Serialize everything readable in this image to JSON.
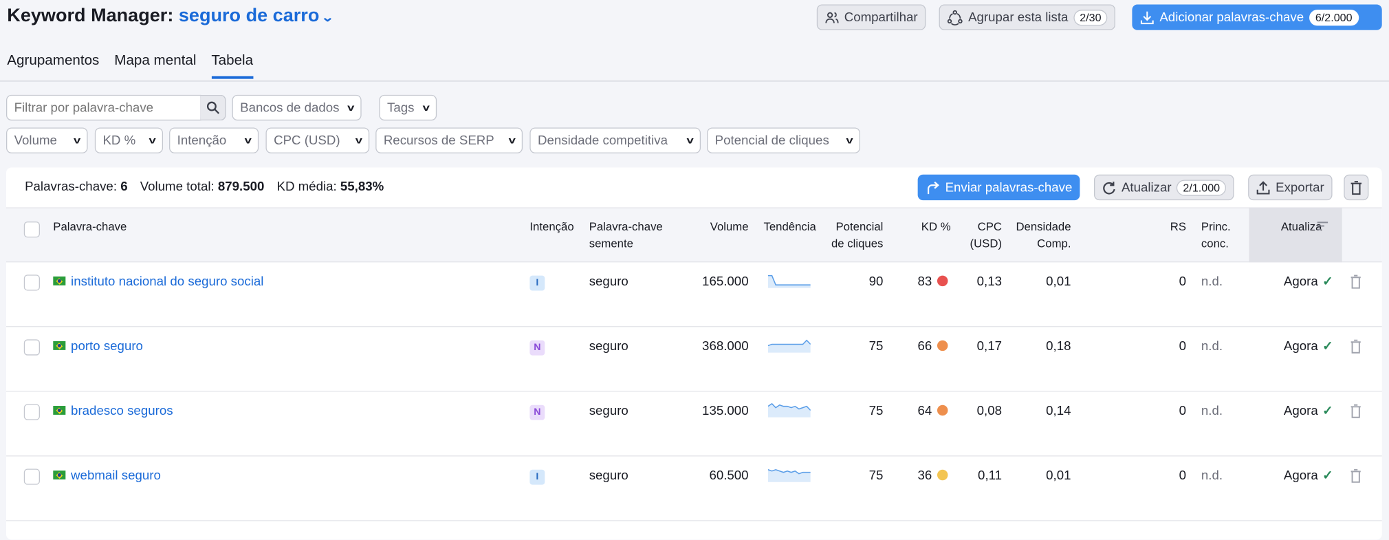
{
  "header": {
    "title": "Keyword Manager:",
    "project": "seguro de carro",
    "share_label": "Compartilhar",
    "group_label": "Agrupar esta lista",
    "group_count": "2/30",
    "add_label": "Adicionar palavras-chave",
    "add_count": "6/2.000"
  },
  "tabs": [
    {
      "label": "Agrupamentos"
    },
    {
      "label": "Mapa mental"
    },
    {
      "label": "Tabela",
      "active": true
    }
  ],
  "filters": {
    "search_placeholder": "Filtrar por palavra-chave",
    "databases": "Bancos de dados",
    "tags": "Tags",
    "volume": "Volume",
    "kd": "KD %",
    "intent": "Intenção",
    "cpc": "CPC (USD)",
    "serp": "Recursos de SERP",
    "density": "Densidade competitiva",
    "clicks": "Potencial de cliques"
  },
  "summary": {
    "keywords_label": "Palavras-chave:",
    "keywords": "6",
    "volume_label": "Volume total:",
    "volume": "879.500",
    "kd_label": "KD média:",
    "kd": "55,83%"
  },
  "toolbar": {
    "send_label": "Enviar palavras-chave",
    "update_label": "Atualizar",
    "update_count": "2/1.000",
    "export_label": "Exportar"
  },
  "columns": {
    "keyword": "Palavra-chave",
    "intent": "Intenção",
    "seed_1": "Palavra-chave",
    "seed_2": "semente",
    "volume": "Volume",
    "trend": "Tendência",
    "clicks_1": "Potencial",
    "clicks_2": "de cliques",
    "kd": "KD %",
    "cpc_1": "CPC",
    "cpc_2": "(USD)",
    "density_1": "Densidade",
    "density_2": "Comp.",
    "rs": "RS",
    "princ_1": "Princ.",
    "princ_2": "conc.",
    "updated": "Atualiza"
  },
  "colors": {
    "accent": "#1a6ad8",
    "button": "#3e8ef0",
    "kd_red": "#e8514f",
    "kd_orange": "#ee8f4d",
    "kd_yellow": "#f3c553"
  },
  "rows": [
    {
      "keyword": "instituto nacional do seguro social",
      "intent": "I",
      "seed": "seguro",
      "volume": "165.000",
      "trend": [
        8,
        8,
        1,
        1,
        1,
        1,
        1,
        1,
        1,
        1,
        1,
        1
      ],
      "clicks": "90",
      "kd": "83",
      "kd_color": "#e8514f",
      "cpc": "0,13",
      "density": "0,01",
      "rs": "0",
      "princ": "n.d.",
      "updated": "Agora"
    },
    {
      "keyword": "porto seguro",
      "intent": "N",
      "seed": "seguro",
      "volume": "368.000",
      "trend": [
        4,
        5,
        5,
        5,
        5,
        5,
        5,
        5,
        5,
        5,
        8,
        5
      ],
      "clicks": "75",
      "kd": "66",
      "kd_color": "#ee8f4d",
      "cpc": "0,17",
      "density": "0,18",
      "rs": "0",
      "princ": "n.d.",
      "updated": "Agora"
    },
    {
      "keyword": "bradesco seguros",
      "intent": "N",
      "seed": "seguro",
      "volume": "135.000",
      "trend": [
        7,
        9,
        6,
        8,
        7,
        7,
        6,
        7,
        5,
        6,
        7,
        4
      ],
      "clicks": "75",
      "kd": "64",
      "kd_color": "#ee8f4d",
      "cpc": "0,08",
      "density": "0,14",
      "rs": "0",
      "princ": "n.d.",
      "updated": "Agora"
    },
    {
      "keyword": "webmail seguro",
      "intent": "I",
      "seed": "seguro",
      "volume": "60.500",
      "trend": [
        8,
        7,
        8,
        7,
        6,
        7,
        6,
        7,
        5,
        6,
        6,
        6
      ],
      "clicks": "75",
      "kd": "36",
      "kd_color": "#f3c553",
      "cpc": "0,11",
      "density": "0,01",
      "rs": "0",
      "princ": "n.d.",
      "updated": "Agora"
    }
  ]
}
